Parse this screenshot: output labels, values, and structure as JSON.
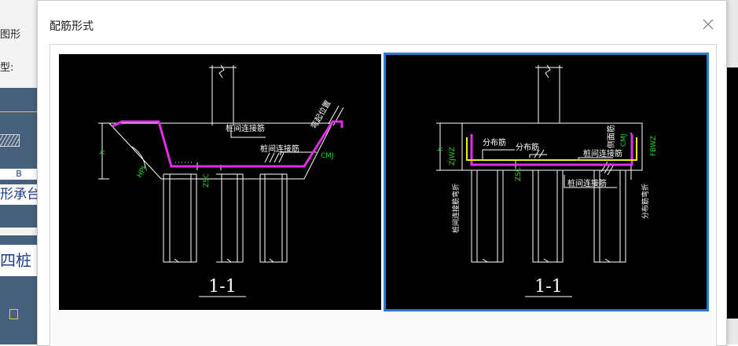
{
  "background": {
    "labels": [
      "图形",
      "型:"
    ],
    "cells": [
      "B",
      "形承台",
      "四桩"
    ]
  },
  "dialog": {
    "title": "配筋形式",
    "close_icon": "close-icon"
  },
  "options": [
    {
      "section_label": "1-1",
      "labels": {
        "top": "桩间连接筋",
        "mid": "桩间连接筋",
        "slope": "弯起位置",
        "cmj": "CMJ",
        "zsc": "ZSC",
        "hpj": "HPJ",
        "h": "h"
      },
      "selected": false
    },
    {
      "section_label": "1-1",
      "labels": {
        "dist1": "分布筋",
        "dist2": "分布筋",
        "conn1": "桩间连接筋",
        "conn2": "桩间连接筋",
        "side": "侧面筋",
        "zjwz": "ZJWZ",
        "fbwz": "FBWZ",
        "cmj": "CMJ",
        "zsc": "ZSC",
        "left_vert": "桩间连接筋弯折",
        "right_vert": "分布筋弯折",
        "h": "h"
      },
      "selected": true
    }
  ],
  "colors": {
    "accent": "#2f7ad1",
    "drawing_bg": "#000000",
    "magenta": "#e22ee8",
    "yellow": "#f2f200",
    "green": "#22d622",
    "white": "#ffffff"
  }
}
